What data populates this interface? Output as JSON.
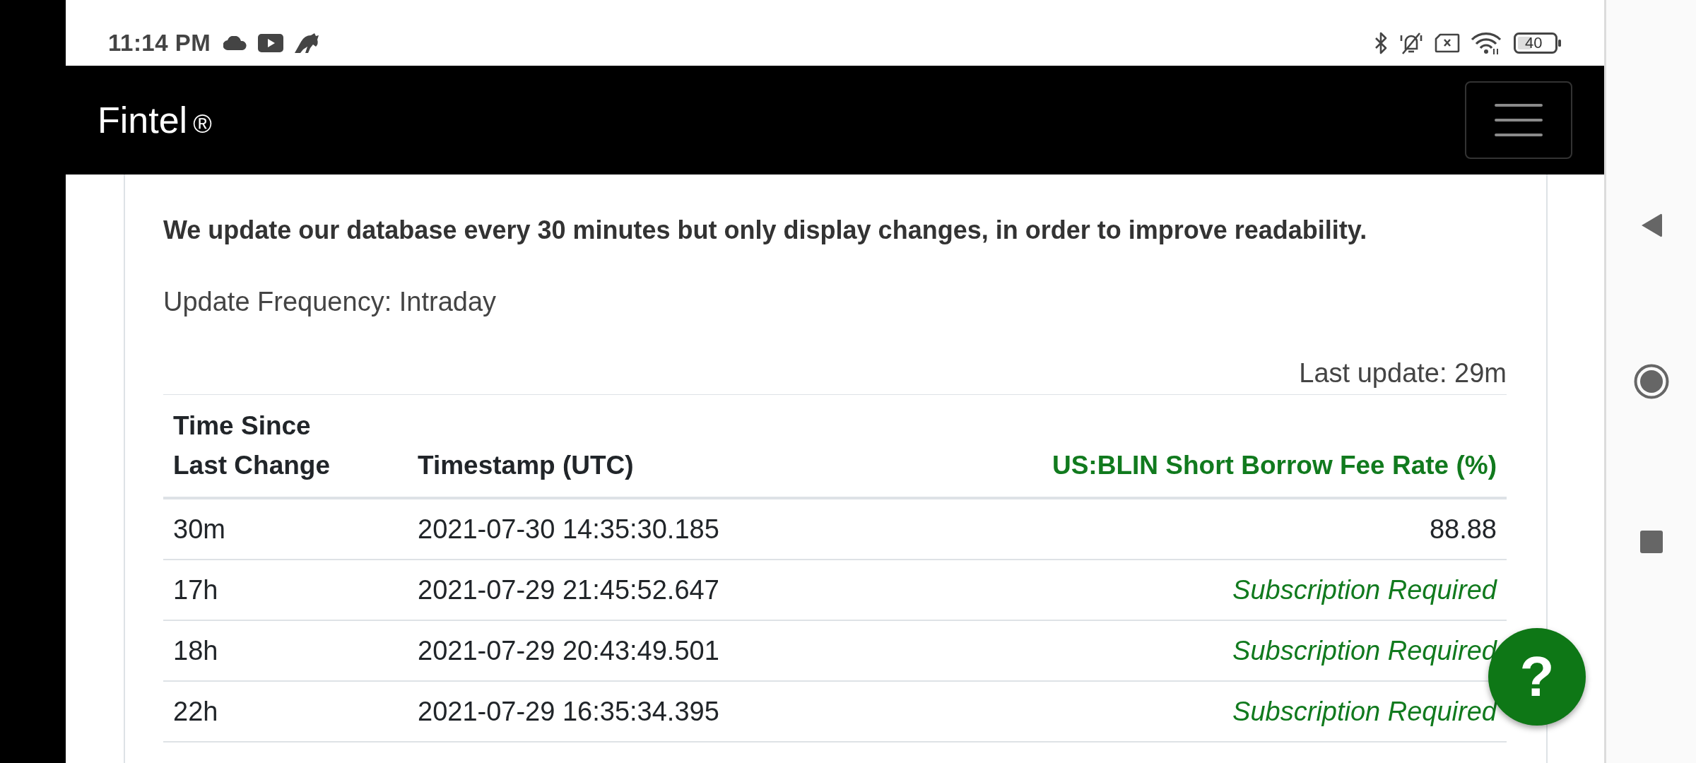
{
  "status_bar": {
    "time": "11:14 PM",
    "battery_text": "40"
  },
  "header": {
    "brand": "Fintel",
    "brand_mark": "®"
  },
  "notice": "We update our database every 30 minutes but only display changes, in order to improve readability.",
  "update_frequency": "Update Frequency: Intraday",
  "last_update": "Last update: 29m",
  "table": {
    "columns": [
      {
        "label": "Time Since Last Change",
        "kind": "text",
        "highlight": false
      },
      {
        "label": "Timestamp (UTC)",
        "kind": "text",
        "highlight": false
      },
      {
        "label": "US:BLIN Short Borrow Fee Rate (%)",
        "kind": "number",
        "highlight": true
      }
    ],
    "rows": [
      {
        "cells": [
          "30m",
          "2021-07-30 14:35:30.185",
          "88.88"
        ],
        "locked": false
      },
      {
        "cells": [
          "17h",
          "2021-07-29 21:45:52.647",
          "Subscription Required"
        ],
        "locked": true
      },
      {
        "cells": [
          "18h",
          "2021-07-29 20:43:49.501",
          "Subscription Required"
        ],
        "locked": true
      },
      {
        "cells": [
          "22h",
          "2021-07-29 16:35:34.395",
          "Subscription Required"
        ],
        "locked": true
      }
    ]
  },
  "help_button": {
    "label": "?"
  }
}
